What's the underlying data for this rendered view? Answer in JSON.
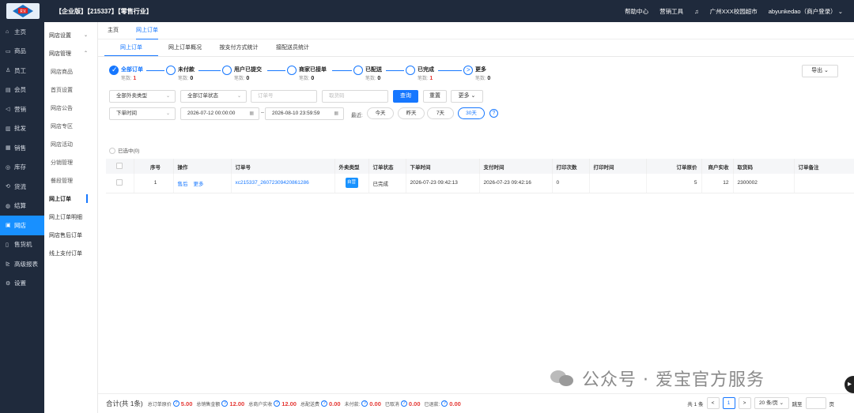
{
  "header": {
    "logo_icon": "aibao-logo-icon",
    "logo_text": "爱宝",
    "brand": "【企业版】【215337】【零售行业】",
    "links": [
      "帮助中心",
      "营销工具"
    ],
    "store": "广州XXX校园超市",
    "user": "abyunkedao（商户登录）",
    "accent": "#1677ff",
    "bg": "#1f2a3c"
  },
  "sidebar": {
    "items": [
      {
        "label": "主页",
        "icon": "home-icon",
        "glyph": "⌂"
      },
      {
        "label": "商品",
        "icon": "box-icon",
        "glyph": "▭"
      },
      {
        "label": "员工",
        "icon": "person-icon",
        "glyph": "♙"
      },
      {
        "label": "会员",
        "icon": "member-icon",
        "glyph": "▤"
      },
      {
        "label": "营销",
        "icon": "megaphone-icon",
        "glyph": "◁"
      },
      {
        "label": "批发",
        "icon": "wholesale-icon",
        "glyph": "▥"
      },
      {
        "label": "销售",
        "icon": "chart-icon",
        "glyph": "▦"
      },
      {
        "label": "库存",
        "icon": "warehouse-icon",
        "glyph": "◎"
      },
      {
        "label": "货流",
        "icon": "flow-icon",
        "glyph": "⟲"
      },
      {
        "label": "结算",
        "icon": "settle-icon",
        "glyph": "◍"
      },
      {
        "label": "网店",
        "icon": "shop-icon",
        "glyph": "▣",
        "active": true
      },
      {
        "label": "售货机",
        "icon": "vending-icon",
        "glyph": "▯"
      },
      {
        "label": "高级报表",
        "icon": "report-icon",
        "glyph": "⊵"
      },
      {
        "label": "设置",
        "icon": "settings-icon",
        "glyph": "⚙"
      }
    ]
  },
  "subsidebar": {
    "items": [
      {
        "label": "网店设置",
        "chev": "⌄",
        "type": "group"
      },
      {
        "label": "网店管理",
        "chev": "⌃",
        "type": "group"
      },
      {
        "label": "网店商品",
        "type": "child"
      },
      {
        "label": "首页设置",
        "type": "child"
      },
      {
        "label": "网店公告",
        "type": "child"
      },
      {
        "label": "网店专区",
        "type": "child"
      },
      {
        "label": "网店活动",
        "type": "child"
      },
      {
        "label": "分销管理",
        "type": "child"
      },
      {
        "label": "餐段管理",
        "type": "child"
      },
      {
        "label": "网上订单",
        "type": "cur"
      },
      {
        "label": "网上订单明细",
        "type": "group"
      },
      {
        "label": "网店售后订单",
        "type": "group"
      },
      {
        "label": "线上支付订单",
        "type": "group"
      }
    ]
  },
  "tabs": {
    "home": "主页",
    "current": "网上订单"
  },
  "subtabs": [
    "网上订单",
    "网上订单概况",
    "按支付方式统计",
    "接配送员统计"
  ],
  "steps": [
    {
      "title": "全部订单",
      "count_label": "笔数:",
      "count": "1",
      "red": true,
      "state": "fill"
    },
    {
      "title": "未付款",
      "count_label": "笔数:",
      "count": "0",
      "state": "empty"
    },
    {
      "title": "用户已提交",
      "count_label": "笔数:",
      "count": "0",
      "state": "empty"
    },
    {
      "title": "商家已接单",
      "count_label": "笔数:",
      "count": "0",
      "state": "empty"
    },
    {
      "title": "已配送",
      "count_label": "笔数:",
      "count": "0",
      "state": "empty"
    },
    {
      "title": "已完成",
      "count_label": "笔数:",
      "count": "1",
      "red": true,
      "state": "empty"
    },
    {
      "title": "更多",
      "count_label": "笔数:",
      "count": "0",
      "state": "more"
    }
  ],
  "export_label": "导出 ⌄",
  "filters": {
    "delivery_type": "全部外卖类型",
    "order_status": "全部订单状态",
    "order_no_placeholder": "订单号",
    "pickup_placeholder": "取货码",
    "query": "查询",
    "reset": "重置",
    "more": "更多 ⌄",
    "time_field": "下单时间",
    "date_from": "2026-07-12 00:00:00",
    "date_sep": "–",
    "date_to": "2026-08-10 23:59:59",
    "recent_label": "最近:",
    "quick": [
      "今天",
      "昨天",
      "7天",
      "30天"
    ],
    "quick_selected": "30天",
    "help": "?",
    "selected_text": "已选中(0)"
  },
  "table": {
    "headers": [
      "",
      "序号",
      "操作",
      "订单号",
      "外卖类型",
      "订单状态",
      "下单时间",
      "支付时间",
      "打印次数",
      "打印时间",
      "订单原价",
      "商户实收",
      "取货码",
      "订单备注"
    ],
    "rows": [
      {
        "seq": "1",
        "op1": "售后",
        "op2": "更多",
        "order_no": "xc215337_26072309420861286",
        "type_badge": "自营",
        "status": "已完成",
        "order_time": "2026-07-23 09:42:13",
        "pay_time": "2026-07-23 09:42:16",
        "print_count": "0",
        "print_time": "",
        "original_price": "5",
        "merchant_received": "12",
        "pickup_code": "2300002",
        "remark": ""
      }
    ]
  },
  "footer": {
    "total": "合计(共 1条)",
    "metrics": [
      {
        "label": "总订单原价",
        "value": "5.00"
      },
      {
        "label": "总销售金额",
        "value": "12.00"
      },
      {
        "label": "总商户实收",
        "value": "12.00"
      },
      {
        "label": "总配送费",
        "value": "0.00"
      },
      {
        "label": "未付款:",
        "value": "0.00"
      },
      {
        "label": "已取消",
        "value": "0.00"
      },
      {
        "label": "已退款:",
        "value": "0.00"
      }
    ],
    "pager": {
      "total": "共 1 条",
      "prev": "<",
      "page": "1",
      "next": ">",
      "size": "20 条/页 ⌄",
      "goto": "跳至",
      "unit": "页"
    }
  },
  "watermark": "公众号 · 爱宝官方服务"
}
